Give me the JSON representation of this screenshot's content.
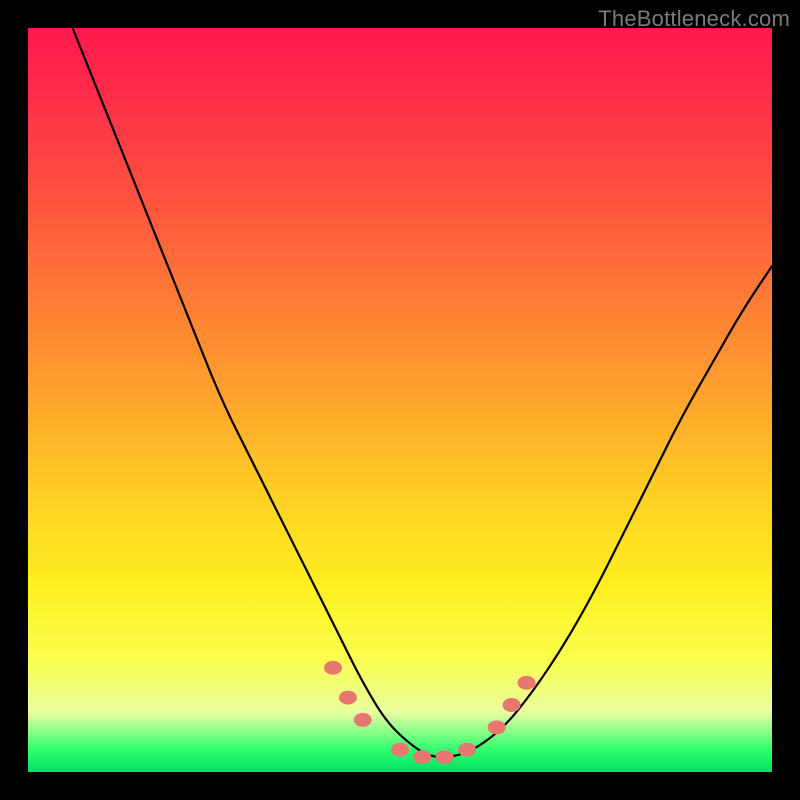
{
  "watermark": {
    "text": "TheBottleneck.com"
  },
  "chart_data": {
    "type": "line",
    "title": "",
    "xlabel": "",
    "ylabel": "",
    "xlim": [
      0,
      100
    ],
    "ylim": [
      0,
      100
    ],
    "grid": false,
    "legend": false,
    "series": [
      {
        "name": "bottleneck-curve",
        "x": [
          6,
          10,
          14,
          18,
          22,
          26,
          30,
          34,
          38,
          42,
          45,
          48,
          51,
          54,
          57,
          60,
          64,
          68,
          72,
          76,
          80,
          84,
          88,
          92,
          96,
          100
        ],
        "y": [
          100,
          90,
          80,
          70,
          60,
          50,
          42,
          34,
          26,
          18,
          12,
          7,
          4,
          2,
          2,
          3,
          6,
          11,
          17,
          24,
          32,
          40,
          48,
          55,
          62,
          68
        ]
      }
    ],
    "markers": [
      {
        "x": 41,
        "y": 14
      },
      {
        "x": 43,
        "y": 10
      },
      {
        "x": 45,
        "y": 7
      },
      {
        "x": 50,
        "y": 3
      },
      {
        "x": 53,
        "y": 2
      },
      {
        "x": 56,
        "y": 2
      },
      {
        "x": 59,
        "y": 3
      },
      {
        "x": 63,
        "y": 6
      },
      {
        "x": 65,
        "y": 9
      },
      {
        "x": 67,
        "y": 12
      }
    ],
    "gradient_stops": [
      {
        "pos": 0,
        "color": "#ff1a4d"
      },
      {
        "pos": 50,
        "color": "#ffa52c"
      },
      {
        "pos": 80,
        "color": "#fff020"
      },
      {
        "pos": 100,
        "color": "#00e060"
      }
    ]
  }
}
